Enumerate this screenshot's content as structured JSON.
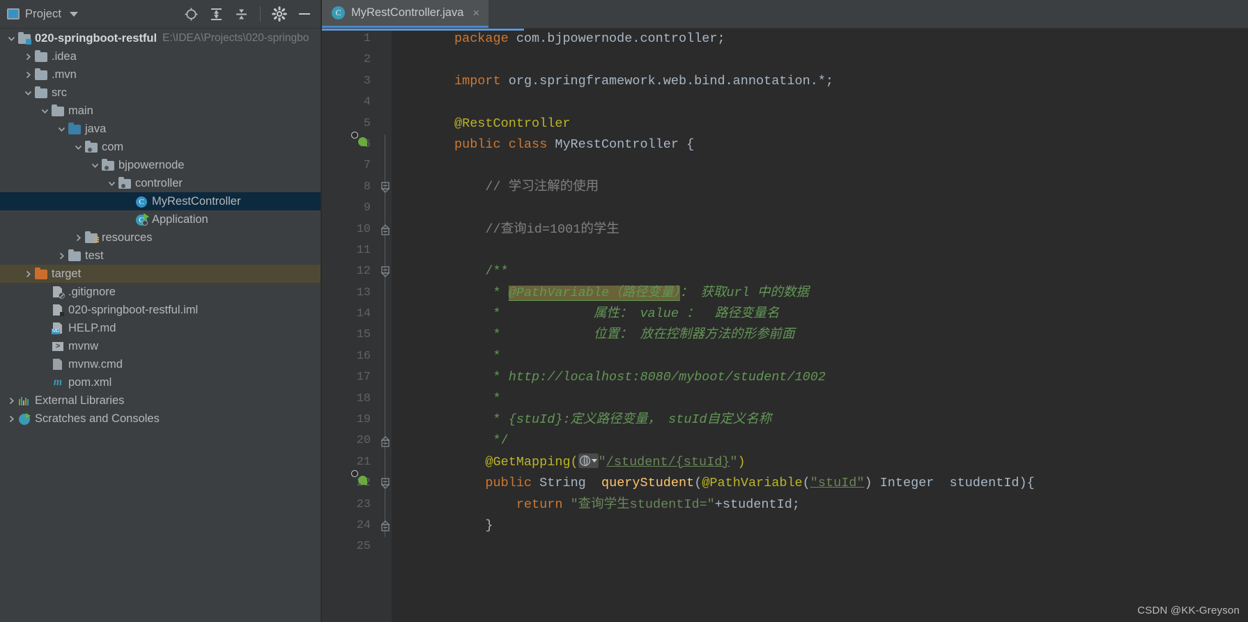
{
  "sidebar": {
    "title": "Project",
    "title_icon": "project-window-icon",
    "toolbar": [
      {
        "name": "locate-icon",
        "glyph": "target"
      },
      {
        "name": "expand-all-icon",
        "glyph": "expand"
      },
      {
        "name": "collapse-all-icon",
        "glyph": "collapse"
      },
      {
        "name": "settings-gear-icon",
        "glyph": "gear"
      },
      {
        "name": "hide-icon",
        "glyph": "minus"
      }
    ],
    "tree": [
      {
        "label": "020-springboot-restful",
        "hint": "E:\\IDEA\\Projects\\020-springbo",
        "depth": 0,
        "arrow": "down",
        "icon": "module-folder",
        "bold": true
      },
      {
        "label": ".idea",
        "hint": "",
        "depth": 1,
        "arrow": "right",
        "icon": "folder",
        "bold": false
      },
      {
        "label": ".mvn",
        "hint": "",
        "depth": 1,
        "arrow": "right",
        "icon": "folder",
        "bold": false
      },
      {
        "label": "src",
        "hint": "",
        "depth": 1,
        "arrow": "down",
        "icon": "folder",
        "bold": false
      },
      {
        "label": "main",
        "hint": "",
        "depth": 2,
        "arrow": "down",
        "icon": "folder",
        "bold": false
      },
      {
        "label": "java",
        "hint": "",
        "depth": 3,
        "arrow": "down",
        "icon": "source-folder",
        "bold": false
      },
      {
        "label": "com",
        "hint": "",
        "depth": 4,
        "arrow": "down",
        "icon": "package",
        "bold": false
      },
      {
        "label": "bjpowernode",
        "hint": "",
        "depth": 5,
        "arrow": "down",
        "icon": "package",
        "bold": false
      },
      {
        "label": "controller",
        "hint": "",
        "depth": 6,
        "arrow": "down",
        "icon": "package",
        "bold": false
      },
      {
        "label": "MyRestController",
        "hint": "",
        "depth": 7,
        "arrow": "none",
        "icon": "java-class",
        "bold": false,
        "selected": true
      },
      {
        "label": "Application",
        "hint": "",
        "depth": 7,
        "arrow": "none",
        "icon": "spring-boot-class",
        "bold": false
      },
      {
        "label": "resources",
        "hint": "",
        "depth": 4,
        "arrow": "right",
        "icon": "resources-folder",
        "bold": false
      },
      {
        "label": "test",
        "hint": "",
        "depth": 3,
        "arrow": "right",
        "icon": "folder",
        "bold": false
      },
      {
        "label": "target",
        "hint": "",
        "depth": 1,
        "arrow": "right",
        "icon": "excluded-folder",
        "bold": false,
        "excluded": true
      },
      {
        "label": ".gitignore",
        "hint": "",
        "depth": 2,
        "arrow": "none",
        "icon": "gitignore-file",
        "bold": false
      },
      {
        "label": "020-springboot-restful.iml",
        "hint": "",
        "depth": 2,
        "arrow": "none",
        "icon": "iml-file",
        "bold": false
      },
      {
        "label": "HELP.md",
        "hint": "",
        "depth": 2,
        "arrow": "none",
        "icon": "markdown-file",
        "bold": false
      },
      {
        "label": "mvnw",
        "hint": "",
        "depth": 2,
        "arrow": "none",
        "icon": "shell-file",
        "bold": false
      },
      {
        "label": "mvnw.cmd",
        "hint": "",
        "depth": 2,
        "arrow": "none",
        "icon": "cmd-file",
        "bold": false
      },
      {
        "label": "pom.xml",
        "hint": "",
        "depth": 2,
        "arrow": "none",
        "icon": "maven-file",
        "bold": false
      },
      {
        "label": "External Libraries",
        "hint": "",
        "depth": 0,
        "arrow": "right",
        "icon": "libraries",
        "bold": false
      },
      {
        "label": "Scratches and Consoles",
        "hint": "",
        "depth": 0,
        "arrow": "right",
        "icon": "scratches",
        "bold": false
      }
    ]
  },
  "editor": {
    "tab": {
      "label": "MyRestController.java",
      "icon": "java-class-icon",
      "close": "×"
    },
    "line_numbers": [
      "1",
      "2",
      "3",
      "4",
      "5",
      "6",
      "7",
      "8",
      "9",
      "10",
      "11",
      "12",
      "13",
      "14",
      "15",
      "16",
      "17",
      "18",
      "19",
      "20",
      "21",
      "22",
      "23",
      "24",
      "25"
    ],
    "lines": [
      {
        "n": 1,
        "text": "package com.bjpowernode.controller;"
      },
      {
        "n": 2,
        "text": ""
      },
      {
        "n": 3,
        "text": "import org.springframework.web.bind.annotation.*;"
      },
      {
        "n": 4,
        "text": ""
      },
      {
        "n": 5,
        "text": "@RestController"
      },
      {
        "n": 6,
        "text": "public class MyRestController {"
      },
      {
        "n": 7,
        "text": ""
      },
      {
        "n": 8,
        "text": "    // 学习注解的使用"
      },
      {
        "n": 9,
        "text": ""
      },
      {
        "n": 10,
        "text": "    //查询id=1001的学生"
      },
      {
        "n": 11,
        "text": ""
      },
      {
        "n": 12,
        "text": "    /**"
      },
      {
        "n": 13,
        "text": "     * @PathVariable（路径变量）： 获取url 中的数据"
      },
      {
        "n": 14,
        "text": "     *            属性： value ：  路径变量名"
      },
      {
        "n": 15,
        "text": "     *            位置： 放在控制器方法的形参前面"
      },
      {
        "n": 16,
        "text": "     *"
      },
      {
        "n": 17,
        "text": "     * http://localhost:8080/myboot/student/1002"
      },
      {
        "n": 18,
        "text": "     *"
      },
      {
        "n": 19,
        "text": "     * {stuId}:定义路径变量， stuId自定义名称"
      },
      {
        "n": 20,
        "text": "     */"
      },
      {
        "n": 21,
        "text": "    @GetMapping(\"/student/{stuId}\")"
      },
      {
        "n": 22,
        "text": "    public String  queryStudent(@PathVariable(\"stuId\") Integer  studentId){"
      },
      {
        "n": 23,
        "text": "        return \"查询学生studentId=\"+studentId;"
      },
      {
        "n": 24,
        "text": "    }"
      },
      {
        "n": 25,
        "text": ""
      }
    ],
    "highlight_text": "@PathVariable（路径变量）",
    "gutter_icons": [
      {
        "line": 6,
        "name": "spring-bean-gutter-icon"
      },
      {
        "line": 22,
        "name": "spring-mapping-gutter-icon"
      }
    ],
    "fold_markers": [
      8,
      10,
      12,
      20,
      22,
      24
    ],
    "url_chip": {
      "name": "web-url-globe-icon",
      "caret": "▾"
    }
  },
  "watermark": {
    "text": "CSDN @KK-Greyson"
  },
  "colors": {
    "accent": "#4a88c7",
    "selection": "#0d293e",
    "excluded": "#4e4935",
    "editor_bg": "#2b2b2b",
    "panel_bg": "#3c3f41",
    "keyword": "#cc7832",
    "annotation": "#bbb529",
    "string": "#6a8759",
    "doc_comment": "#629755",
    "comment": "#808080",
    "method": "#ffc66d",
    "highlight_bg": "#6b6338"
  }
}
